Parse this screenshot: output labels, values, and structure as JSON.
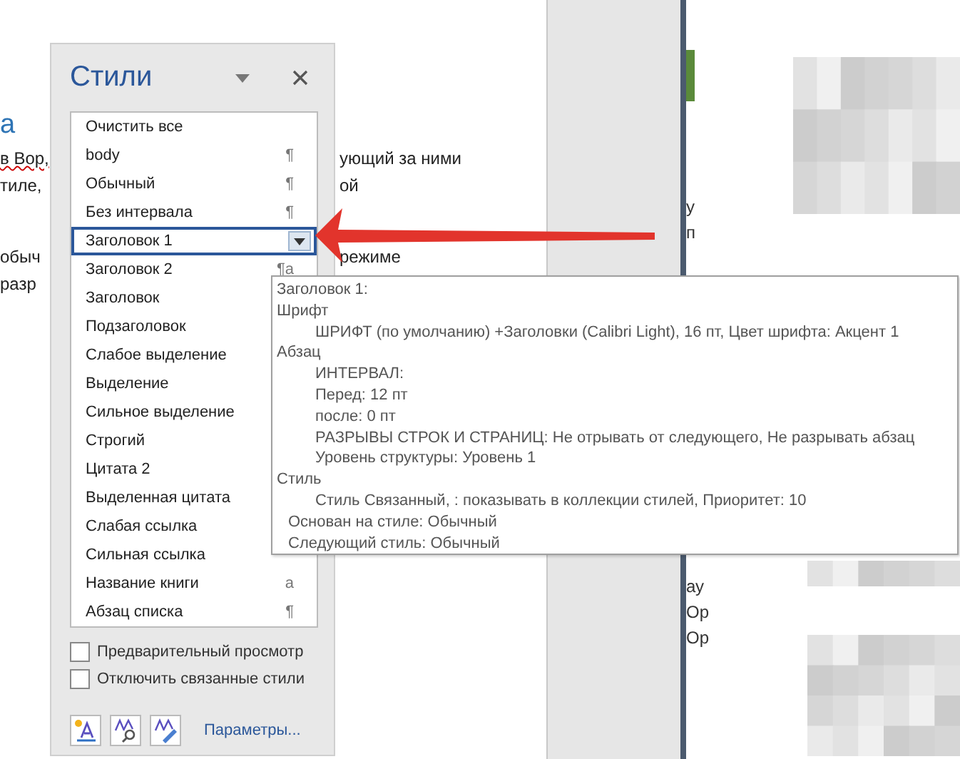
{
  "document": {
    "heading_fragment": "а",
    "paragraphs": [
      [
        {
          "left": "в Вор,",
          "right": "ующий за ними",
          "left_underlined": true
        },
        {
          "left": "тиле,",
          "right": "ой",
          "left_underlined": false
        }
      ],
      [
        {
          "left": "обыч",
          "right": "режиме",
          "left_underlined": false
        },
        {
          "left": "разр",
          "left_underlined": false
        }
      ]
    ]
  },
  "side_fragments": [
    "у",
    "п",
    "ау",
    "Ор",
    "Ор"
  ],
  "styles_pane": {
    "title": "Стили",
    "items": [
      {
        "name": "Очистить все",
        "selected": false
      },
      {
        "name": "body",
        "mark": "¶",
        "selected": false
      },
      {
        "name": "Обычный",
        "mark": "¶",
        "selected": false
      },
      {
        "name": "Без интервала",
        "mark": "¶",
        "selected": false
      },
      {
        "name": "Заголовок 1",
        "selected": true
      },
      {
        "name": "Заголовок 2",
        "mark": "¶a",
        "selected": false
      },
      {
        "name": "Заголовок",
        "selected": false
      },
      {
        "name": "Подзаголовок",
        "selected": false
      },
      {
        "name": "Слабое выделение",
        "selected": false
      },
      {
        "name": "Выделение",
        "selected": false
      },
      {
        "name": "Сильное выделение",
        "selected": false
      },
      {
        "name": "Строгий",
        "selected": false
      },
      {
        "name": "Цитата 2",
        "selected": false
      },
      {
        "name": "Выделенная цитата",
        "selected": false
      },
      {
        "name": "Слабая ссылка",
        "selected": false
      },
      {
        "name": "Сильная ссылка",
        "selected": false
      },
      {
        "name": "Название книги",
        "mark": "a",
        "selected": false
      },
      {
        "name": "Абзац списка",
        "mark": "¶",
        "selected": false
      }
    ],
    "options": [
      {
        "label": "Предварительный просмотр",
        "checked": false
      },
      {
        "label": "Отключить связанные стили",
        "checked": false
      }
    ],
    "link": "Параметры..."
  },
  "tooltip": {
    "title": "Заголовок 1:",
    "sections": [
      {
        "label": "Шрифт",
        "children": [
          "ШРИФТ (по умолчанию) +Заголовки (Calibri Light), 16 пт, Цвет шрифта: Акцент 1"
        ]
      },
      {
        "label": "Абзац",
        "children": [
          "ИНТЕРВАЛ:",
          "Перед:  12 пт",
          "после: 0 пт",
          "РАЗРЫВЫ СТРОК И СТРАНИЦ: Не отрывать от следующего, Не разрывать абзац",
          "Уровень структуры:  Уровень 1"
        ]
      },
      {
        "label": "Стиль",
        "children": [
          "Стиль Связанный, : показывать в коллекции стилей, Приоритет: 10"
        ]
      }
    ],
    "footer_lines": [
      "Основан на стиле: Обычный",
      "Следующий стиль: Обычный"
    ]
  }
}
